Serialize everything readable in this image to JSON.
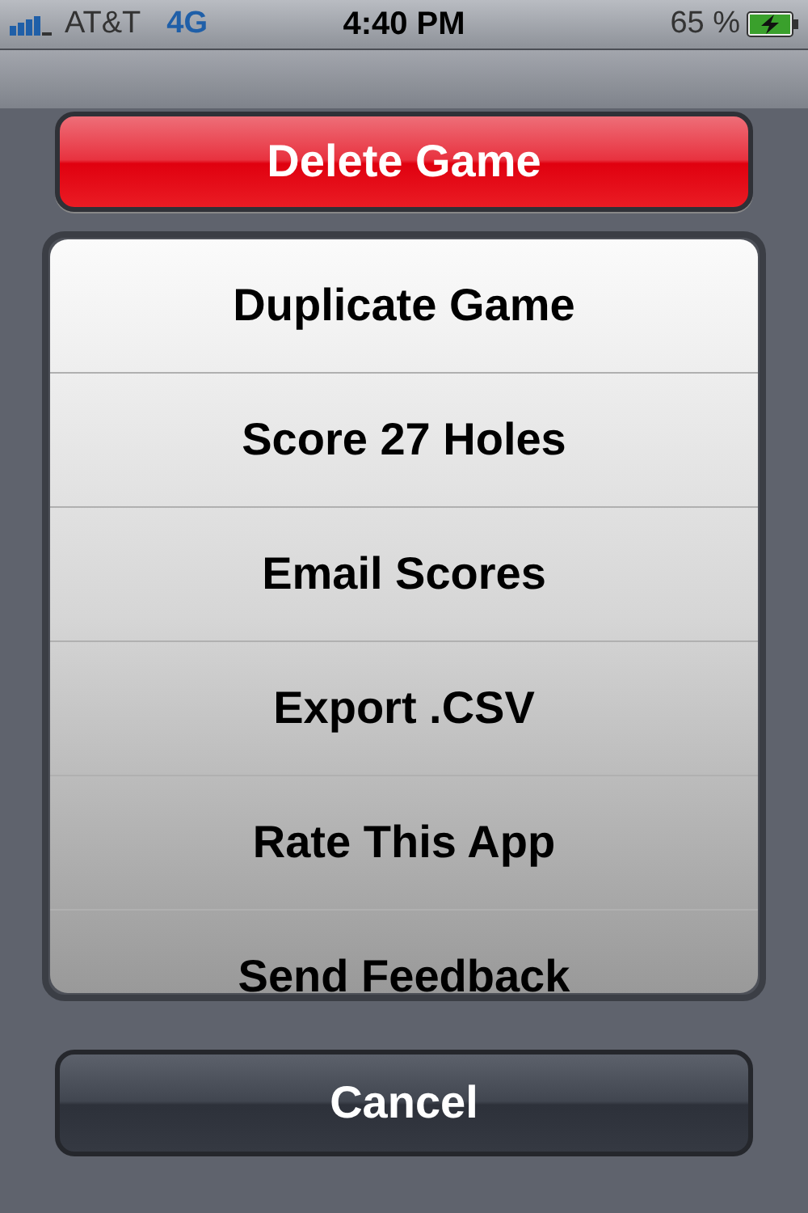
{
  "status_bar": {
    "carrier": "AT&T",
    "network": "4G",
    "time": "4:40 PM",
    "battery": "65 %",
    "charging": true
  },
  "action_sheet": {
    "destructive": "Delete Game",
    "options": [
      "Duplicate Game",
      "Score 27 Holes",
      "Email Scores",
      "Export .CSV",
      "Rate This App",
      "Send Feedback"
    ],
    "cancel": "Cancel"
  }
}
